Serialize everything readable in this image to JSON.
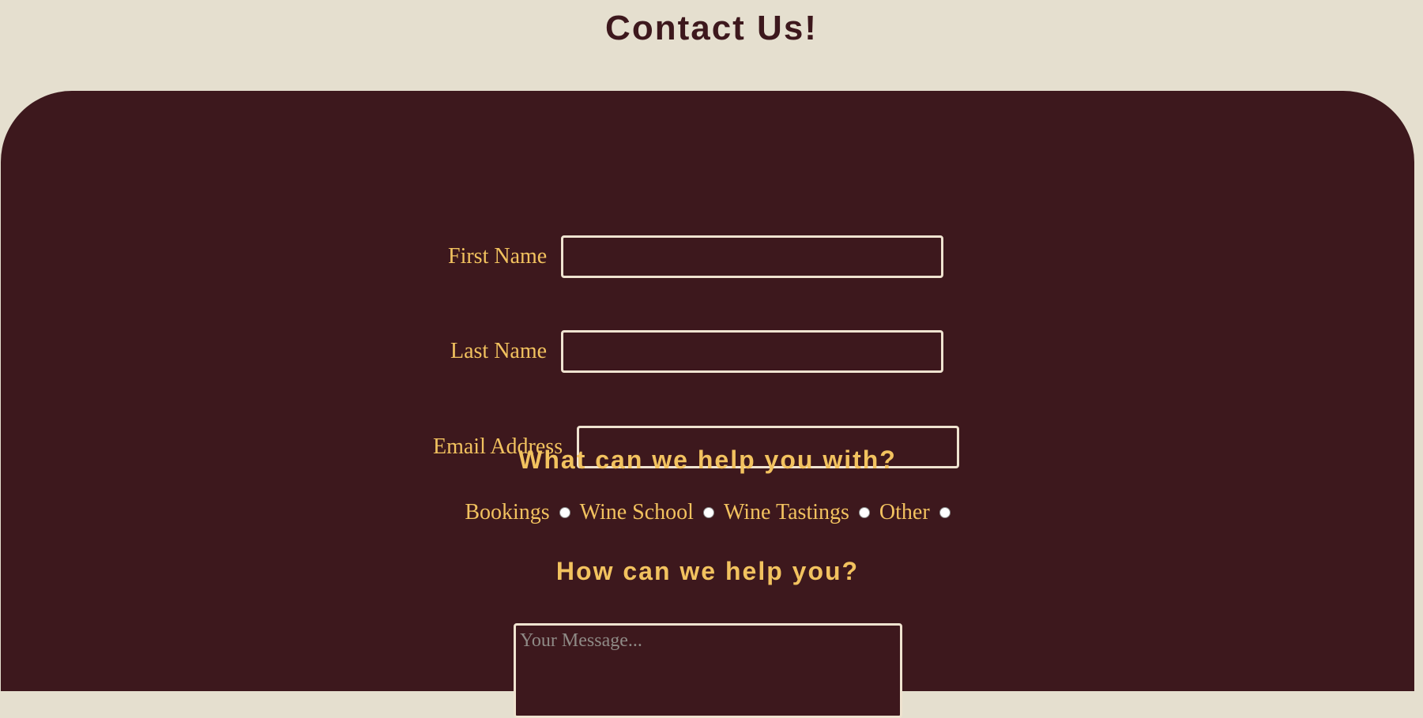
{
  "header": {
    "title": "Contact Us!"
  },
  "form": {
    "first_name": {
      "label": "First Name",
      "value": ""
    },
    "last_name": {
      "label": "Last Name",
      "value": ""
    },
    "email": {
      "label": "Email Address",
      "value": ""
    },
    "help_with_heading": "What can we help you with?",
    "options": [
      {
        "label": "Bookings",
        "selected": false
      },
      {
        "label": "Wine School",
        "selected": false
      },
      {
        "label": "Wine Tastings",
        "selected": false
      },
      {
        "label": "Other",
        "selected": false
      }
    ],
    "help_you_heading": "How can we help you?",
    "message": {
      "placeholder": "Your Message...",
      "value": ""
    }
  },
  "colors": {
    "page_background": "#e5dfcf",
    "panel_background": "#3d181d",
    "accent_text": "#f2c25f",
    "input_border": "#efe3d0"
  }
}
